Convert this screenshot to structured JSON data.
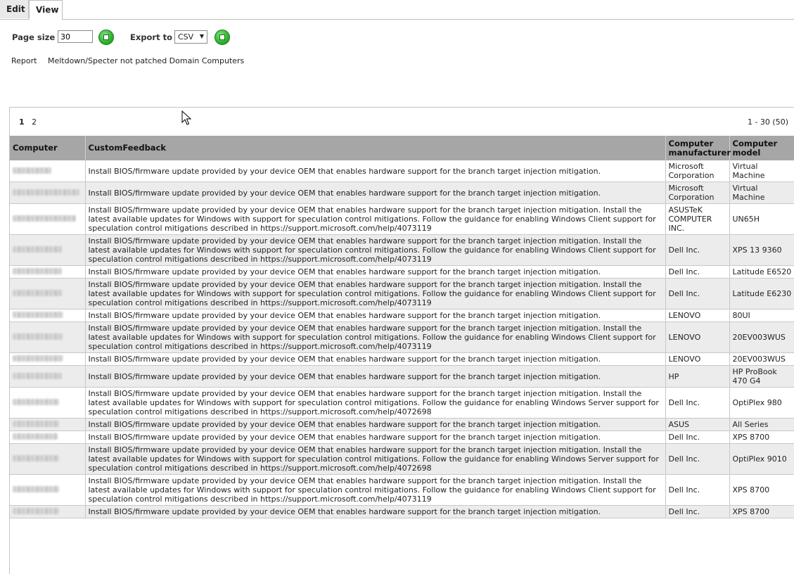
{
  "tabs": [
    {
      "label": "Edit"
    },
    {
      "label": "View"
    }
  ],
  "toolbar": {
    "page_size_label": "Page size",
    "page_size_value": "30",
    "export_label": "Export to",
    "export_value": "CSV"
  },
  "report": {
    "label": "Report",
    "name": "Meltdown/Specter not patched Domain Computers"
  },
  "pager": {
    "pages": [
      "1",
      "2"
    ],
    "current": "1",
    "range": "1 - 30 (50)"
  },
  "columns": [
    "Computer",
    "CustomFeedback",
    "Computer manufacturer",
    "Computer model"
  ],
  "rows": [
    {
      "computer": "",
      "feedback": "Install BIOS/firmware update provided by your device OEM that enables hardware support for the branch target injection mitigation.",
      "manufacturer": "Microsoft Corporation",
      "model": "Virtual Machine"
    },
    {
      "computer": "",
      "feedback": "Install BIOS/firmware update provided by your device OEM that enables hardware support for the branch target injection mitigation.",
      "manufacturer": "Microsoft Corporation",
      "model": "Virtual Machine"
    },
    {
      "computer": "",
      "feedback": "Install BIOS/firmware update provided by your device OEM that enables hardware support for the branch target injection mitigation. Install the latest available updates for Windows with support for speculation control mitigations. Follow the guidance for enabling Windows Client support for speculation control mitigations described in https://support.microsoft.com/help/4073119",
      "manufacturer": "ASUSTeK COMPUTER INC.",
      "model": "UN65H"
    },
    {
      "computer": "",
      "feedback": "Install BIOS/firmware update provided by your device OEM that enables hardware support for the branch target injection mitigation. Install the latest available updates for Windows with support for speculation control mitigations. Follow the guidance for enabling Windows Client support for speculation control mitigations described in https://support.microsoft.com/help/4073119",
      "manufacturer": "Dell Inc.",
      "model": "XPS 13 9360"
    },
    {
      "computer": "",
      "feedback": "Install BIOS/firmware update provided by your device OEM that enables hardware support for the branch target injection mitigation.",
      "manufacturer": "Dell Inc.",
      "model": "Latitude E6520"
    },
    {
      "computer": "",
      "feedback": "Install BIOS/firmware update provided by your device OEM that enables hardware support for the branch target injection mitigation. Install the latest available updates for Windows with support for speculation control mitigations. Follow the guidance for enabling Windows Client support for speculation control mitigations described in https://support.microsoft.com/help/4073119",
      "manufacturer": "Dell Inc.",
      "model": "Latitude E6230"
    },
    {
      "computer": "",
      "feedback": "Install BIOS/firmware update provided by your device OEM that enables hardware support for the branch target injection mitigation.",
      "manufacturer": "LENOVO",
      "model": "80UI"
    },
    {
      "computer": "",
      "feedback": "Install BIOS/firmware update provided by your device OEM that enables hardware support for the branch target injection mitigation. Install the latest available updates for Windows with support for speculation control mitigations. Follow the guidance for enabling Windows Client support for speculation control mitigations described in https://support.microsoft.com/help/4073119",
      "manufacturer": "LENOVO",
      "model": "20EV003WUS"
    },
    {
      "computer": "",
      "feedback": "Install BIOS/firmware update provided by your device OEM that enables hardware support for the branch target injection mitigation.",
      "manufacturer": "LENOVO",
      "model": "20EV003WUS"
    },
    {
      "computer": "",
      "feedback": "Install BIOS/firmware update provided by your device OEM that enables hardware support for the branch target injection mitigation.",
      "manufacturer": "HP",
      "model": "HP ProBook 470 G4"
    },
    {
      "computer": "",
      "feedback": "Install BIOS/firmware update provided by your device OEM that enables hardware support for the branch target injection mitigation. Install the latest available updates for Windows with support for speculation control mitigations. Follow the guidance for enabling Windows Server support for speculation control mitigations described in https://support.microsoft.com/help/4072698",
      "manufacturer": "Dell Inc.",
      "model": "OptiPlex 980"
    },
    {
      "computer": "",
      "feedback": "Install BIOS/firmware update provided by your device OEM that enables hardware support for the branch target injection mitigation.",
      "manufacturer": "ASUS",
      "model": "All Series"
    },
    {
      "computer": "",
      "feedback": "Install BIOS/firmware update provided by your device OEM that enables hardware support for the branch target injection mitigation.",
      "manufacturer": "Dell Inc.",
      "model": "XPS 8700"
    },
    {
      "computer": "",
      "feedback": "Install BIOS/firmware update provided by your device OEM that enables hardware support for the branch target injection mitigation. Install the latest available updates for Windows with support for speculation control mitigations. Follow the guidance for enabling Windows Server support for speculation control mitigations described in https://support.microsoft.com/help/4072698",
      "manufacturer": "Dell Inc.",
      "model": "OptiPlex 9010"
    },
    {
      "computer": "",
      "feedback": "Install BIOS/firmware update provided by your device OEM that enables hardware support for the branch target injection mitigation. Install the latest available updates for Windows with support for speculation control mitigations. Follow the guidance for enabling Windows Client support for speculation control mitigations described in https://support.microsoft.com/help/4073119",
      "manufacturer": "Dell Inc.",
      "model": "XPS 8700"
    },
    {
      "computer": "",
      "feedback": "Install BIOS/firmware update provided by your device OEM that enables hardware support for the branch target injection mitigation.",
      "manufacturer": "Dell Inc.",
      "model": "XPS 8700"
    }
  ],
  "icons": {
    "page_size_go": "go-button-icon",
    "export_go": "go-button-icon",
    "cursor": "mouse-pointer-icon"
  },
  "colors": {
    "header_bg": "#a6a6a6",
    "row_even": "#ececec",
    "go_green": "#2fb62f"
  }
}
